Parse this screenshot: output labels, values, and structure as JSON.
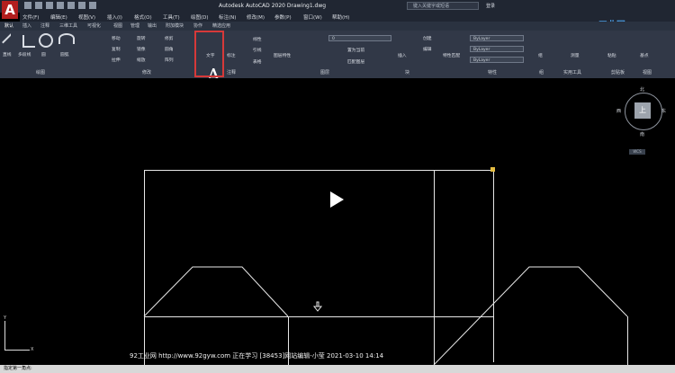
{
  "app": {
    "title": "Autodesk AutoCAD 2020    Drawing1.dwg",
    "search_placeholder": "键入关键字或短语",
    "login_label": "登录"
  },
  "menu": [
    "文件(F)",
    "编辑(E)",
    "视图(V)",
    "插入(I)",
    "格式(O)",
    "工具(T)",
    "绘图(D)",
    "标注(N)",
    "修改(M)",
    "参数(P)",
    "窗口(W)",
    "帮助(H)"
  ],
  "tabs": [
    "默认",
    "插入",
    "注释",
    "三维工具",
    "可视化",
    "视图",
    "管理",
    "输出",
    "附加模块",
    "协作",
    "精选应用"
  ],
  "ribbon": {
    "groups": [
      "绘图",
      "修改",
      "注释",
      "图层",
      "块",
      "特性",
      "组",
      "实用工具",
      "剪贴板",
      "视图"
    ],
    "draw_tools": [
      "直线",
      "多段线",
      "圆",
      "圆弧"
    ],
    "modify_tools": [
      "移动",
      "旋转",
      "修剪",
      "复制",
      "镜像",
      "圆角",
      "拉伸",
      "缩放",
      "阵列"
    ],
    "annotation_tools": [
      "文字",
      "标注",
      "线性",
      "引线",
      "表格"
    ],
    "layer_tools": [
      "图层特性",
      "置为当前",
      "匹配图层"
    ],
    "layer_selected": "0",
    "block_tools": [
      "插入",
      "创建",
      "编辑"
    ],
    "property_tools": [
      "特性匹配"
    ],
    "properties": [
      "ByLayer",
      "ByLayer",
      "ByLayer"
    ],
    "group_tool": "组",
    "utility_tool": "测量",
    "clipboard_tool": "粘贴",
    "view_tool": "基点"
  },
  "watermark": "92工业网",
  "compass": {
    "north": "北",
    "south": "南",
    "east": "东",
    "west": "西",
    "top": "上",
    "wcs": "WCS"
  },
  "ucs": {
    "x": "X",
    "y": "Y"
  },
  "footer": "92工业网 http://www.92gyw.com 正在学习 [38453]网站编辑-小莹 2021-03-10 14:14",
  "commandline": "指定第一角点:"
}
